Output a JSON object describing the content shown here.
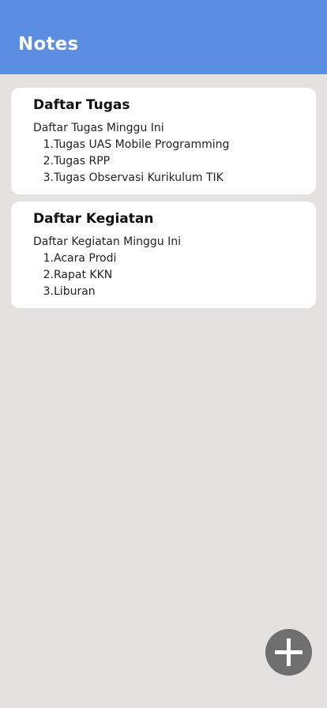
{
  "app_bar": {
    "title": "Notes",
    "background_color": "#5b8de3"
  },
  "notes": [
    {
      "title": "Daftar Tugas",
      "subtitle": "Daftar Tugas Minggu Ini",
      "items": [
        {
          "number": "1.",
          "text": "Tugas UAS Mobile Programming"
        },
        {
          "number": "2.",
          "text": "Tugas RPP"
        },
        {
          "number": "3.",
          "text": "Tugas Observasi Kurikulum TIK"
        }
      ]
    },
    {
      "title": "Daftar Kegiatan",
      "subtitle": "Daftar Kegiatan Minggu Ini",
      "items": [
        {
          "number": "1.",
          "text": "Acara Prodi"
        },
        {
          "number": "2.",
          "text": "Rapat KKN"
        },
        {
          "number": "3.",
          "text": "Liburan"
        }
      ]
    }
  ],
  "fab": {
    "icon": "plus-icon",
    "color": "#6f6f6f"
  },
  "colors": {
    "background": "#e3e2e0",
    "card": "#ffffff"
  }
}
